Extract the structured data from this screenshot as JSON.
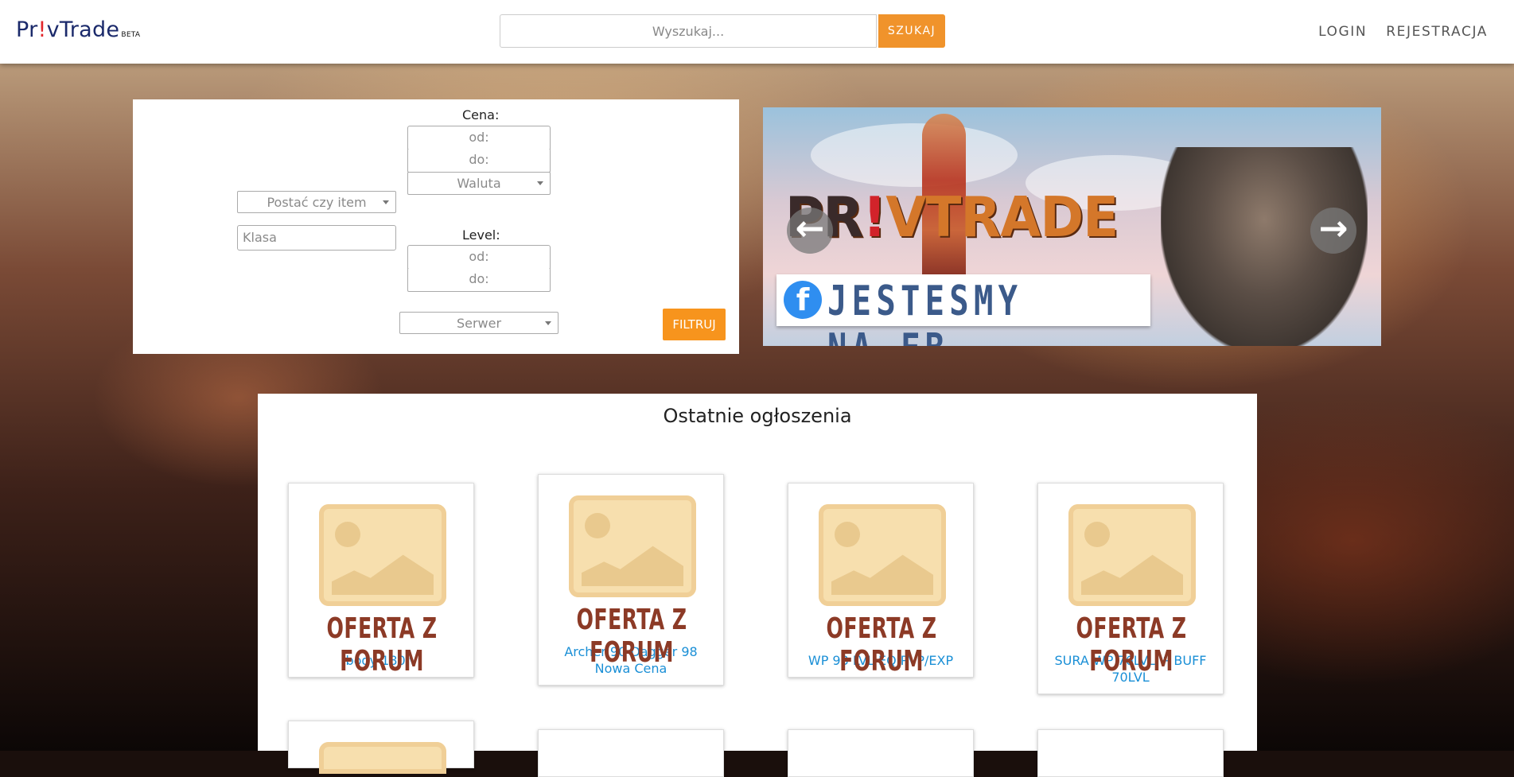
{
  "header": {
    "logo": {
      "pre": "Pr",
      "bang": "!",
      "post": "vTrade",
      "badge": "BETA"
    },
    "search": {
      "placeholder": "Wyszukaj...",
      "button": "SZUKAJ"
    },
    "nav": [
      "LOGIN",
      "REJESTRACJA"
    ]
  },
  "filter": {
    "price_label": "Cena:",
    "price_from": "od:",
    "price_to": "do:",
    "currency": "Waluta",
    "type_select": "Postać czy item",
    "class_placeholder": "Klasa",
    "level_label": "Level:",
    "level_from": "od:",
    "level_to": "do:",
    "server": "Serwer",
    "submit": "FILTRUJ"
  },
  "banner": {
    "logo_pr": "PR",
    "logo_bang": "!",
    "logo_rest": "VTRADE",
    "fb_icon": "f",
    "fb_text": "JESTESMY NA FB",
    "prev_icon": "arrow-left-icon",
    "next_icon": "arrow-right-icon"
  },
  "offers": {
    "title": "Ostatnie ogłoszenia",
    "stamp": "OFERTA Z FORUM",
    "items": [
      {
        "title": "body 180lv"
      },
      {
        "title": "Archer 90 Dagger 98 Nowa Cena"
      },
      {
        "title": "WP 93 LVL EQ PVP/EXP"
      },
      {
        "title": "SURA WP 76LVL + BUFF 70LVL"
      }
    ]
  },
  "colors": {
    "accent": "#f0932b",
    "link": "#1a8fd6",
    "brand": "#1b2a6b"
  }
}
